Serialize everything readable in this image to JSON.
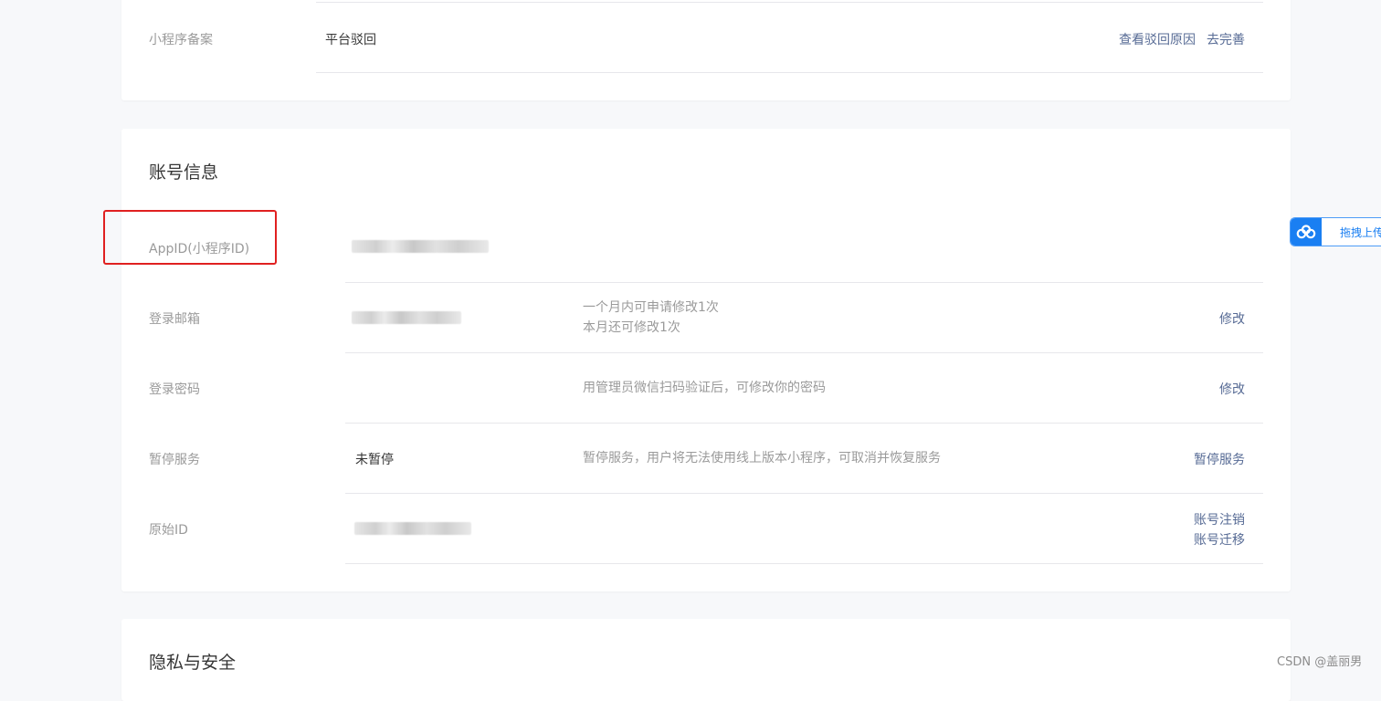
{
  "filing_section": {
    "label": "小程序备案",
    "status": "平台驳回",
    "actions": [
      "查看驳回原因",
      "去完善"
    ]
  },
  "account_section": {
    "title": "账号信息",
    "rows": [
      {
        "label": "AppID(小程序ID)",
        "value": "",
        "desc": [],
        "actions": []
      },
      {
        "label": "登录邮箱",
        "value": "",
        "desc": [
          "一个月内可申请修改1次",
          "本月还可修改1次"
        ],
        "actions": [
          "修改"
        ]
      },
      {
        "label": "登录密码",
        "value": "",
        "desc": [
          "用管理员微信扫码验证后，可修改你的密码"
        ],
        "actions": [
          "修改"
        ]
      },
      {
        "label": "暂停服务",
        "value": "未暂停",
        "desc": [
          "暂停服务，用户将无法使用线上版本小程序，可取消并恢复服务"
        ],
        "actions": [
          "暂停服务"
        ]
      },
      {
        "label": "原始ID",
        "value": "",
        "desc": [],
        "actions": [
          "账号注销",
          "账号迁移"
        ]
      }
    ]
  },
  "privacy_section": {
    "title": "隐私与安全"
  },
  "upload_widget": {
    "label": "拖拽上传",
    "icon": "cloud-icon",
    "color": "#1a7ff2"
  },
  "watermark": "CSDN @盖丽男",
  "colors": {
    "link": "#576b95",
    "highlight": "#e02020",
    "background": "#f7f8fa"
  }
}
